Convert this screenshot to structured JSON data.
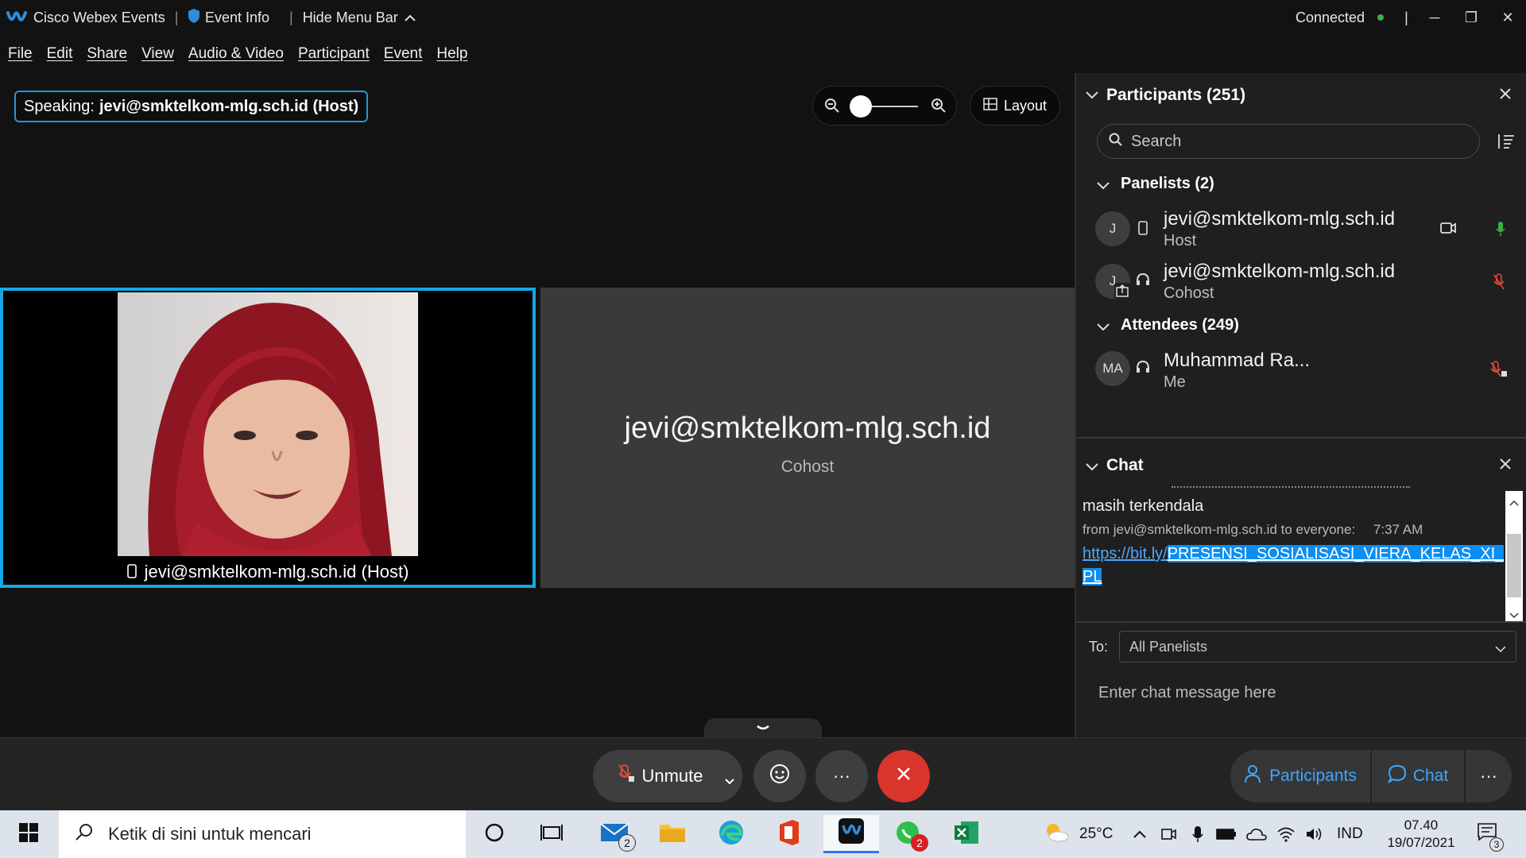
{
  "titlebar": {
    "app_name": "Cisco Webex Events",
    "event_info": "Event Info",
    "hide_menu": "Hide Menu Bar",
    "status": "Connected",
    "status_color": "#3cb043"
  },
  "menu": [
    "File",
    "Edit",
    "Share",
    "View",
    "Audio & Video",
    "Participant",
    "Event",
    "Help"
  ],
  "stage": {
    "speaking_prefix": "Speaking:",
    "speaking_name": "jevi@smktelkom-mlg.sch.id (Host)",
    "layout_label": "Layout",
    "video1_label": "jevi@smktelkom-mlg.sch.id (Host)",
    "video2_name": "jevi@smktelkom-mlg.sch.id",
    "video2_role": "Cohost"
  },
  "controls": {
    "unmute": "Unmute",
    "more": "···",
    "participants": "Participants",
    "chat": "Chat"
  },
  "participants": {
    "title": "Participants (251)",
    "search_placeholder": "Search",
    "panelists_title": "Panelists (2)",
    "panelists": [
      {
        "initial": "J",
        "name": "jevi@smktelkom-mlg.sch.id",
        "role": "Host"
      },
      {
        "initial": "J",
        "name": "jevi@smktelkom-mlg.sch.id",
        "role": "Cohost"
      }
    ],
    "attendees_title": "Attendees (249)",
    "attendees": [
      {
        "initial": "MA",
        "name": "Muhammad Ra...",
        "role": "Me"
      }
    ]
  },
  "chat": {
    "title": "Chat",
    "line1": "masih terkendala",
    "meta": "from jevi@smktelkom-mlg.sch.id to everyone:",
    "time": "7:37 AM",
    "link_plain": "https://bit.ly/",
    "link_highlight1": "PRESENSI_SOSIALISASI_VIERA_KELAS_XI_R",
    "link_highlight2": "PL",
    "to_label": "To:",
    "to_value": "All Panelists",
    "input_placeholder": "Enter chat message here"
  },
  "taskbar": {
    "search_placeholder": "Ketik di sini untuk mencari",
    "mail_badge": "2",
    "whatsapp_badge": "2",
    "temperature": "25°C",
    "language": "IND",
    "time": "07.40",
    "date": "19/07/2021",
    "notif_count": "3"
  }
}
